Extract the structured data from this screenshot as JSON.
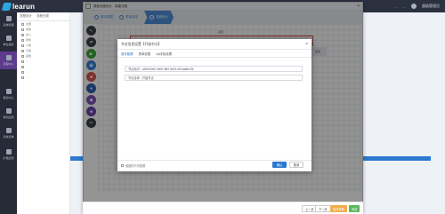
{
  "app": {
    "brand": "learun",
    "header_right": [
      "…",
      "…",
      "超级管理员"
    ]
  },
  "leftnav": {
    "items": [
      {
        "label": "系统管理"
      },
      {
        "label": "单位组织"
      },
      {
        "label": "流程中心"
      },
      {
        "label": "报表中心"
      },
      {
        "label": "移动应用"
      },
      {
        "label": "系统表单"
      },
      {
        "label": "扩展应用"
      }
    ]
  },
  "leftpanel": {
    "tabs": [
      "流程设计",
      "流程分类"
    ],
    "rows": [
      "全部",
      "通用",
      "办公",
      "财务",
      "人事",
      "行政",
      "其他",
      "…",
      "…",
      "…",
      "…"
    ]
  },
  "designer": {
    "title": "模板流程设计 - 新建流程",
    "close": "×",
    "steps": [
      {
        "label": "基本配置"
      },
      {
        "label": "表单选择"
      },
      {
        "label": "流程设计"
      }
    ]
  },
  "toolbar": {
    "tools": [
      "cursor-icon",
      "connector-icon",
      "start-icon",
      "task-icon",
      "stop-icon",
      "user-icon",
      "merge-icon",
      "branch-icon",
      "condition-icon"
    ]
  },
  "canvas": {
    "start_label": "开始",
    "top_label": "驳回",
    "end_label": "结束"
  },
  "modal": {
    "title": "节点信息设置【开始节点】",
    "close": "×",
    "tabs": [
      "基本配置",
      "表单权限",
      "sql字段设置"
    ],
    "fields": [
      {
        "text": "节点标识：a3f2d20fe1 8ef5 4fb5 9b23 c0f1aa8b1f0f"
      },
      {
        "text": "节点名称：开始节点"
      }
    ],
    "footer_checkbox": "驳回时只可查看",
    "ok_label": "确认",
    "cancel_label": "取消"
  },
  "footer": {
    "prev_label": "上一步",
    "next_label": "下一步",
    "draft_label": "保存草稿",
    "finish_label": "完成"
  }
}
